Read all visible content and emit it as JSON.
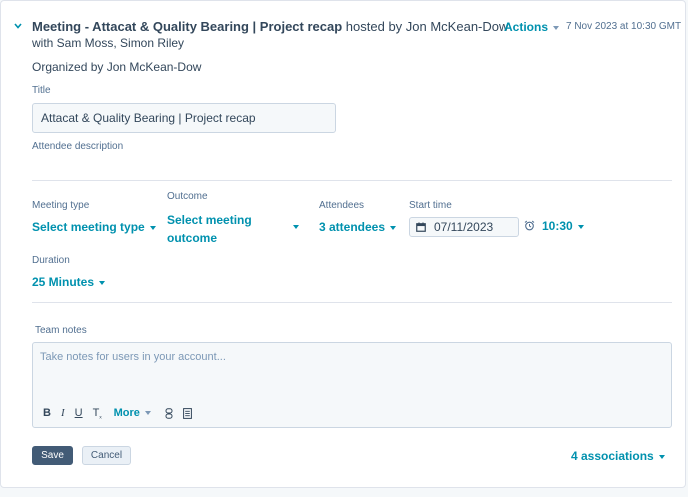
{
  "header": {
    "title_bold": "Meeting - Attacat & Quality Bearing | Project recap",
    "hosted_by": "hosted by Jon McKean-Dow",
    "with_line": "with Sam Moss, Simon Riley",
    "actions_label": "Actions",
    "timestamp": "7 Nov 2023 at 10:30 GMT"
  },
  "organized_by": "Organized by Jon McKean-Dow",
  "title_field": {
    "label": "Title",
    "value": "Attacat & Quality Bearing | Project recap"
  },
  "attendee_description_label": "Attendee description",
  "meeting_type": {
    "label": "Meeting type",
    "value": "Select meeting type"
  },
  "outcome": {
    "label": "Outcome",
    "value_line1": "Select meeting",
    "value_line2": "outcome"
  },
  "attendees": {
    "label": "Attendees",
    "value": "3 attendees"
  },
  "start_time": {
    "label": "Start time",
    "date": "07/11/2023",
    "time": "10:30"
  },
  "duration": {
    "label": "Duration",
    "value": "25 Minutes"
  },
  "team_notes": {
    "label": "Team notes",
    "placeholder": "Take notes for users in your account...",
    "toolbar": {
      "bold": "B",
      "italic": "I",
      "underline": "U",
      "clear_format": "T",
      "more": "More"
    }
  },
  "buttons": {
    "save": "Save",
    "cancel": "Cancel"
  },
  "associations": "4 associations",
  "colors": {
    "link": "#0091ae",
    "text": "#33475b",
    "save_bg": "#425b76",
    "border": "#cbd6e2"
  }
}
